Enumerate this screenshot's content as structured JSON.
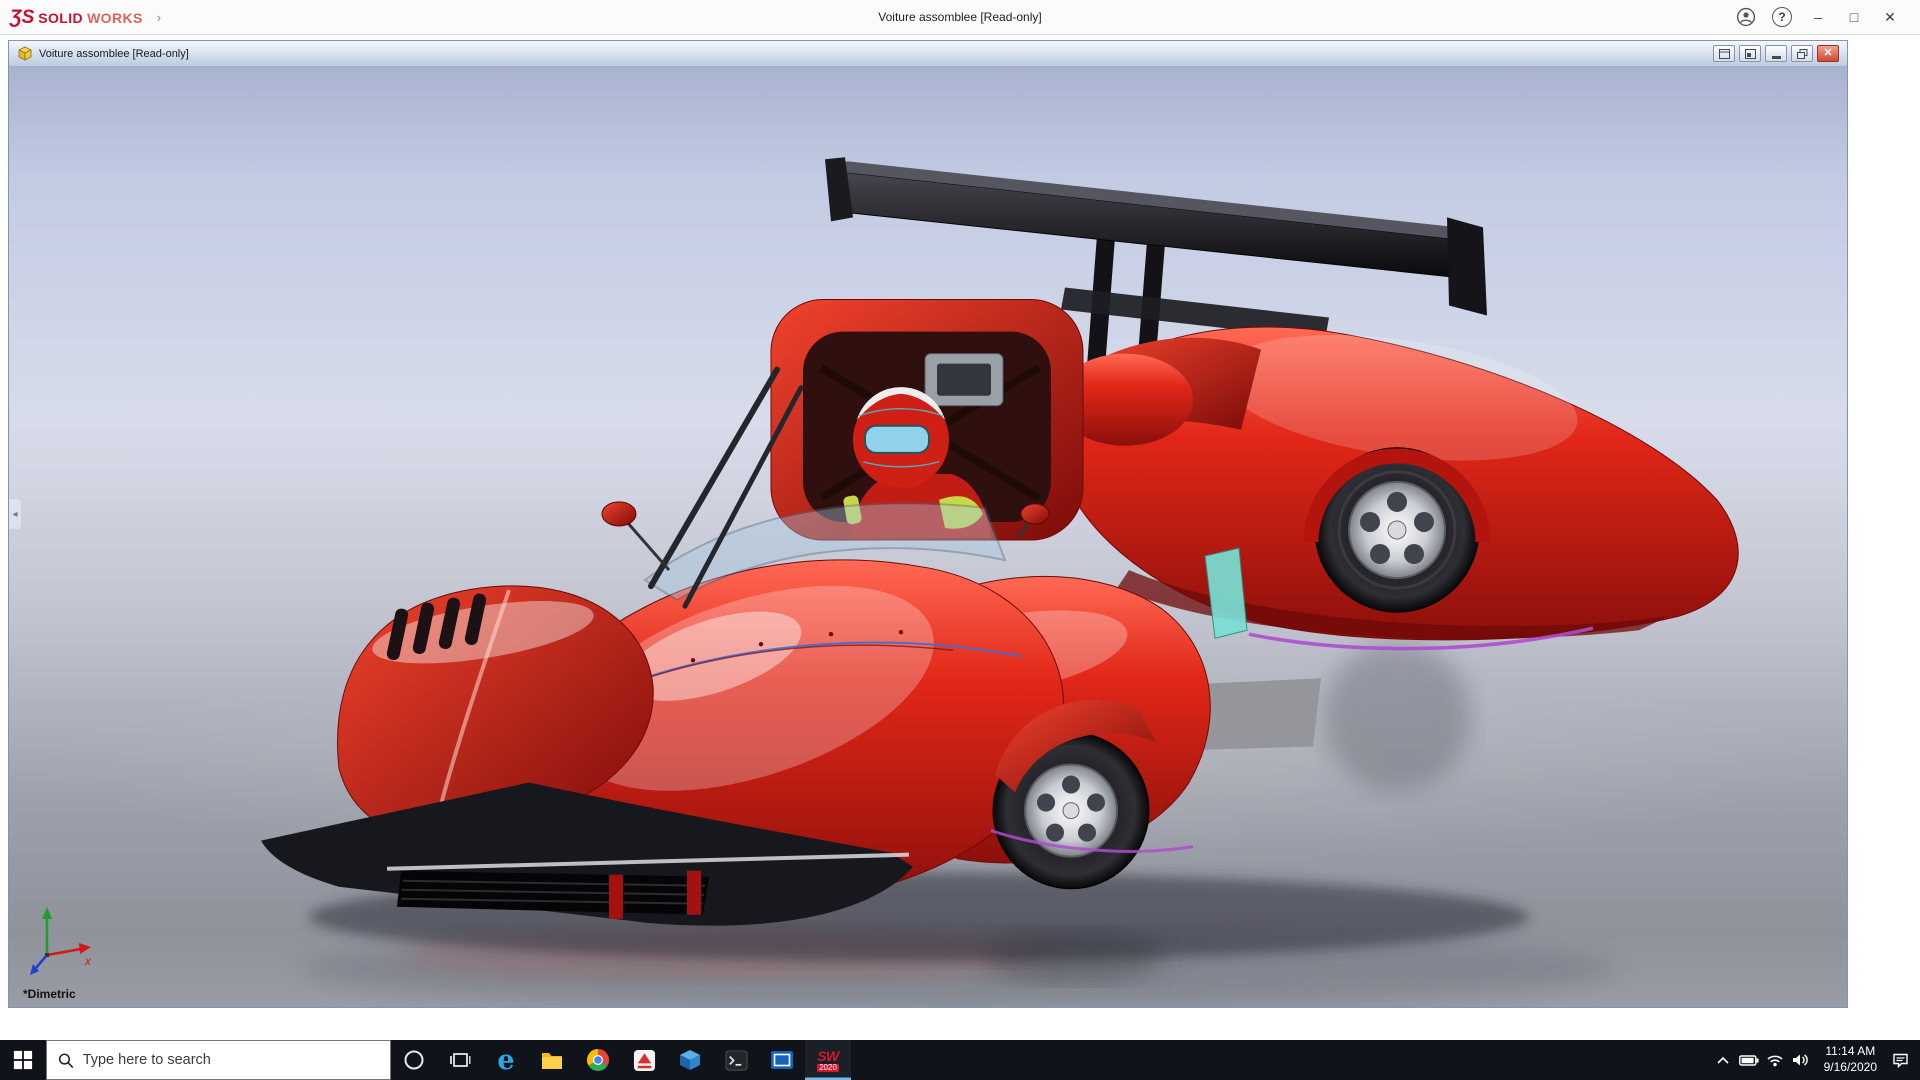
{
  "app": {
    "brand": {
      "ds_mark": "ƷS",
      "solid": "SOLID",
      "works": "WORKS",
      "expand_arrow": "›"
    },
    "title": "Voiture assomblee [Read-only]",
    "controls": {
      "help": "?",
      "minimize": "–",
      "maximize": "□",
      "close": "✕"
    }
  },
  "document": {
    "title": "Voiture assomblee [Read-only]",
    "controls": {
      "close": "✕"
    }
  },
  "viewport": {
    "orientation_label": "*Dimetric",
    "triad": {
      "x_label": "x"
    },
    "background_top": "#a9b2cf",
    "background_bottom": "#999ca4",
    "car_body_color": "#d42318",
    "rear_wing_color": "#16161a"
  },
  "taskbar": {
    "search_placeholder": "Type here to search",
    "solidworks_badge": {
      "letters": "SW",
      "year": "2020"
    },
    "clock": {
      "time": "11:14 AM",
      "date": "9/16/2020"
    }
  },
  "colors": {
    "brand_red": "#c8102e",
    "taskbar_bg": "#10141a",
    "doc_close_red": "#cf4931"
  }
}
